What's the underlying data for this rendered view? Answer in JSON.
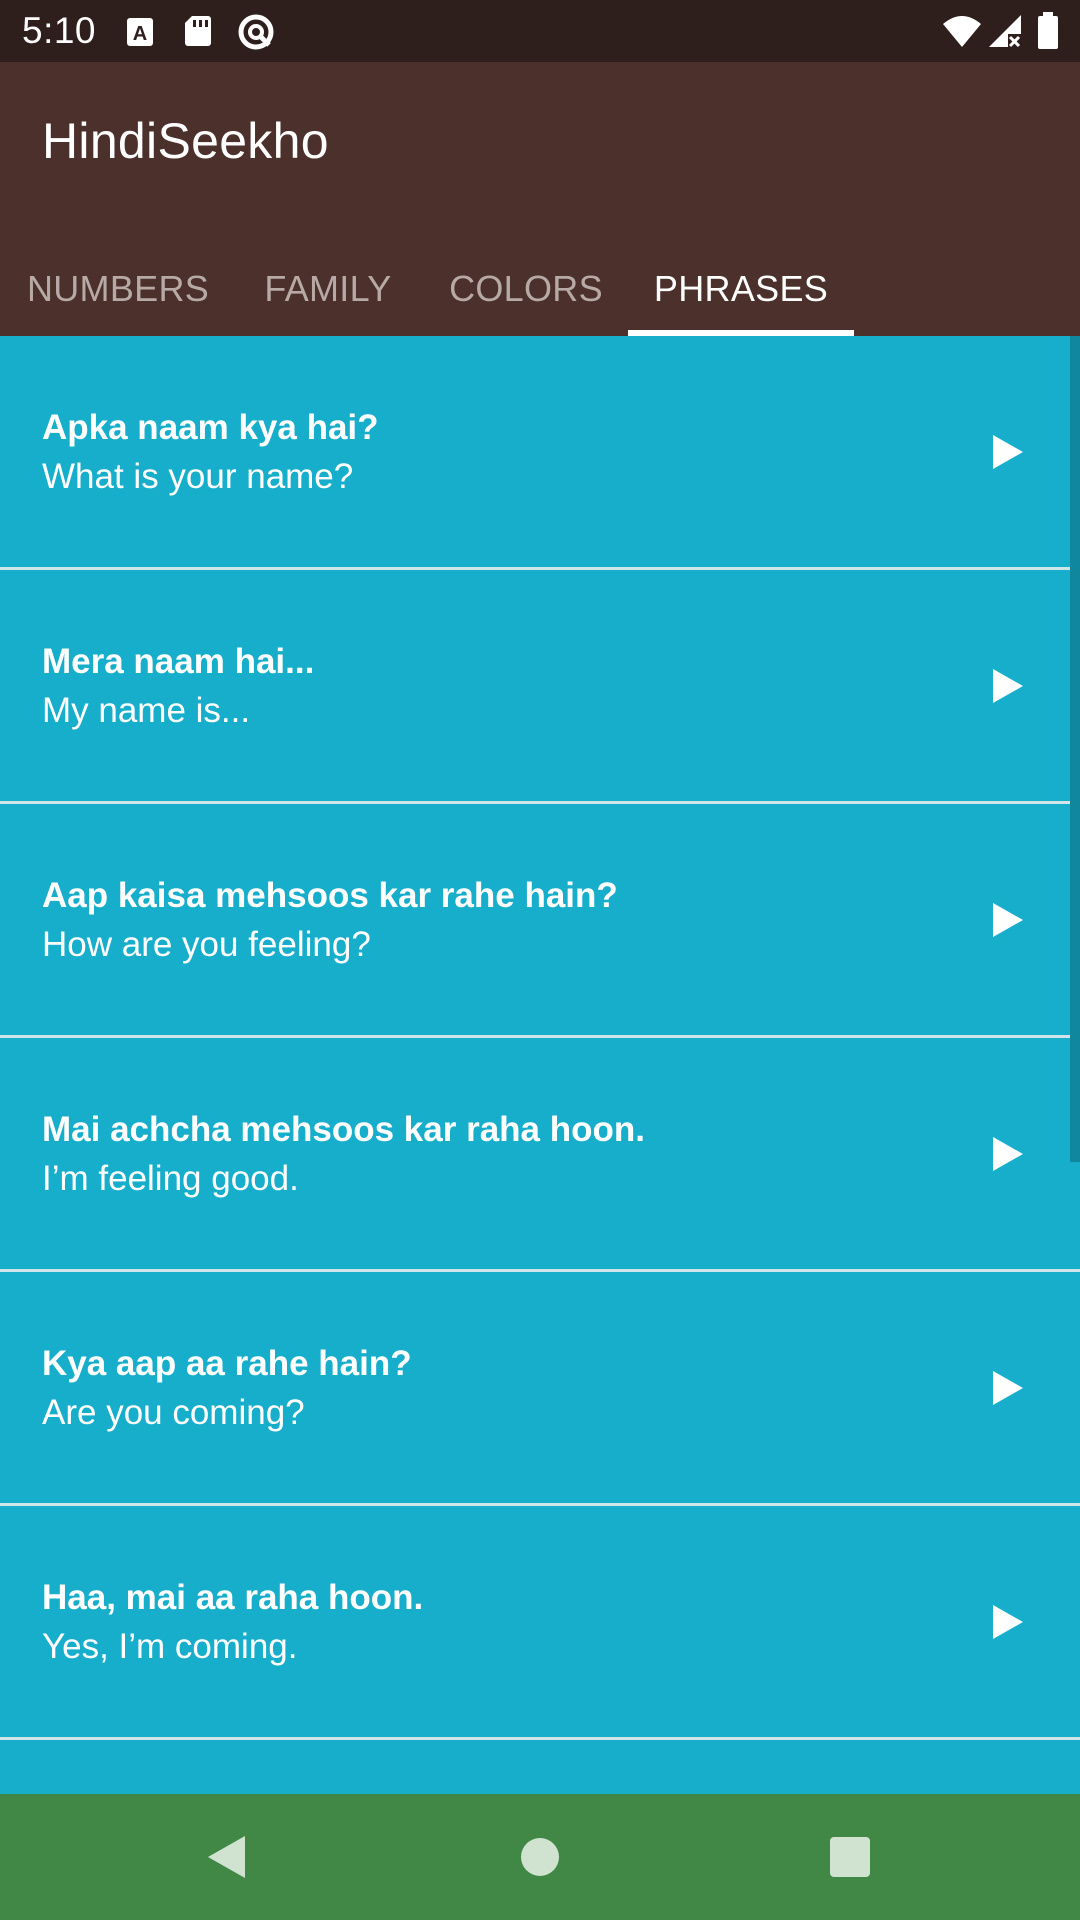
{
  "status_bar": {
    "time": "5:10",
    "left_icons": [
      "font-a-icon",
      "sd-card-icon",
      "at-sign-icon"
    ],
    "right_icons": [
      "wifi-icon",
      "cell-signal-icon",
      "battery-icon"
    ]
  },
  "app_bar": {
    "title": "HindiSeekho",
    "background_color": "#4b302b"
  },
  "tabs": [
    {
      "label": "NUMBERS",
      "active": false
    },
    {
      "label": "FAMILY",
      "active": false
    },
    {
      "label": "COLORS",
      "active": false
    },
    {
      "label": "PHRASES",
      "active": true
    }
  ],
  "phrases": [
    {
      "hindi": "Apka naam kya hai?",
      "english": "What is your name?"
    },
    {
      "hindi": "Mera naam hai...",
      "english": "My name is..."
    },
    {
      "hindi": "Aap kaisa mehsoos kar rahe hain?",
      "english": "How are you feeling?"
    },
    {
      "hindi": "Mai achcha mehsoos kar raha hoon.",
      "english": "I’m feeling good."
    },
    {
      "hindi": "Kya aap aa rahe hain?",
      "english": "Are you coming?"
    },
    {
      "hindi": "Haa, mai aa raha hoon.",
      "english": "Yes, I’m coming."
    }
  ],
  "list_background_color": "#16aecb",
  "nav_bar": {
    "background_color": "#418847",
    "buttons": [
      "back-icon",
      "home-icon",
      "recents-icon"
    ]
  }
}
